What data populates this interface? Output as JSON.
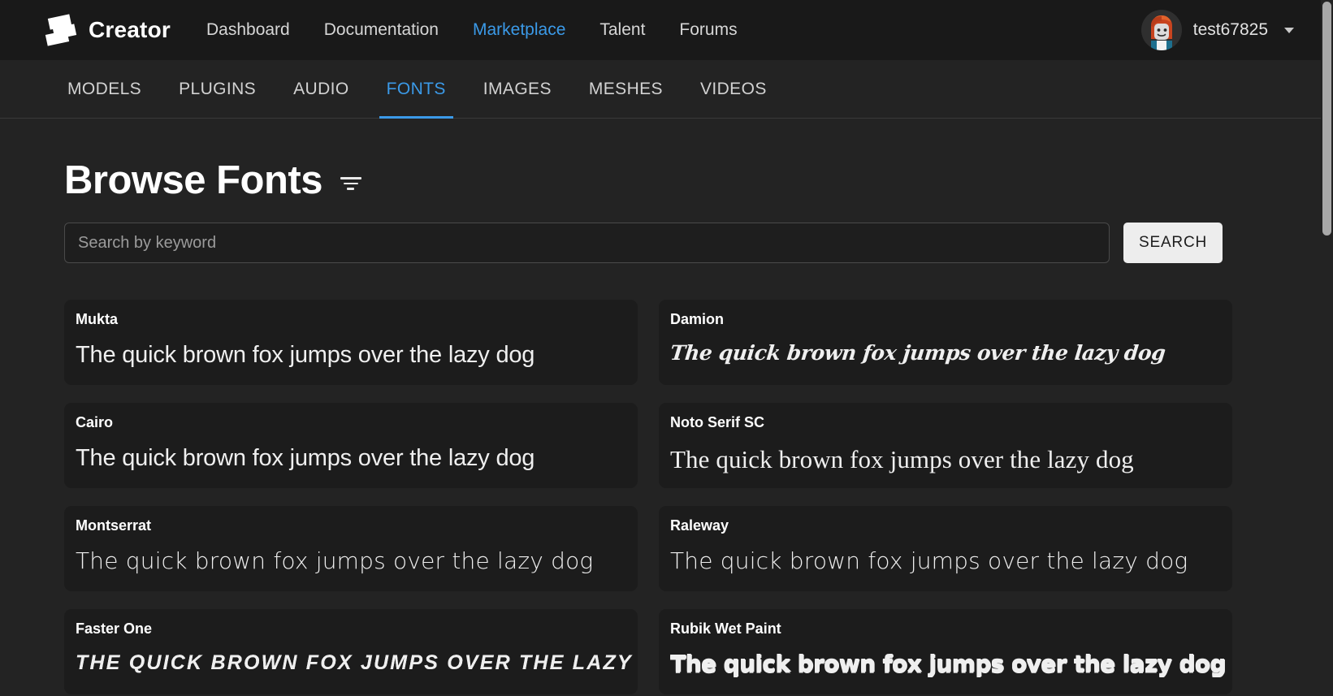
{
  "header": {
    "logo_icon": "roblox-studio-logo-icon",
    "brand": "Creator",
    "nav": [
      {
        "label": "Dashboard",
        "active": false
      },
      {
        "label": "Documentation",
        "active": false
      },
      {
        "label": "Marketplace",
        "active": true
      },
      {
        "label": "Talent",
        "active": false
      },
      {
        "label": "Forums",
        "active": false
      }
    ],
    "user": {
      "name": "test67825",
      "avatar_icon": "user-avatar",
      "caret_icon": "chevron-down-icon"
    }
  },
  "tabs": [
    {
      "label": "MODELS",
      "active": false
    },
    {
      "label": "PLUGINS",
      "active": false
    },
    {
      "label": "AUDIO",
      "active": false
    },
    {
      "label": "FONTS",
      "active": true
    },
    {
      "label": "IMAGES",
      "active": false
    },
    {
      "label": "MESHES",
      "active": false
    },
    {
      "label": "VIDEOS",
      "active": false
    }
  ],
  "main": {
    "title": "Browse Fonts",
    "filter_icon": "filter-icon",
    "search": {
      "value": "",
      "placeholder": "Search by keyword",
      "button_label": "SEARCH"
    },
    "fonts": [
      {
        "name": "Mukta",
        "sample": "The quick brown fox jumps over the lazy dog",
        "style": "s-sans"
      },
      {
        "name": "Damion",
        "sample": "The quick brown fox jumps over the lazy dog",
        "style": "s-script"
      },
      {
        "name": "Cairo",
        "sample": "The quick brown fox jumps over the lazy dog",
        "style": "s-sans"
      },
      {
        "name": "Noto Serif SC",
        "sample": "The quick brown fox jumps over the lazy dog",
        "style": "s-serif"
      },
      {
        "name": "Montserrat",
        "sample": "The quick brown fox jumps over the lazy dog",
        "style": "s-sans-light"
      },
      {
        "name": "Raleway",
        "sample": "The quick brown fox jumps over the lazy dog",
        "style": "s-sans-light"
      },
      {
        "name": "Faster One",
        "sample": "The quick brown fox jumps over the lazy d",
        "style": "s-speed"
      },
      {
        "name": "Rubik Wet Paint",
        "sample": "The quick brown fox jumps over the lazy dog",
        "style": "s-paint"
      }
    ]
  },
  "colors": {
    "accent": "#3b9ae8",
    "page_background": "#232323",
    "header_background": "#191919",
    "card_background": "#1c1c1c",
    "search_button": "#ededed"
  }
}
